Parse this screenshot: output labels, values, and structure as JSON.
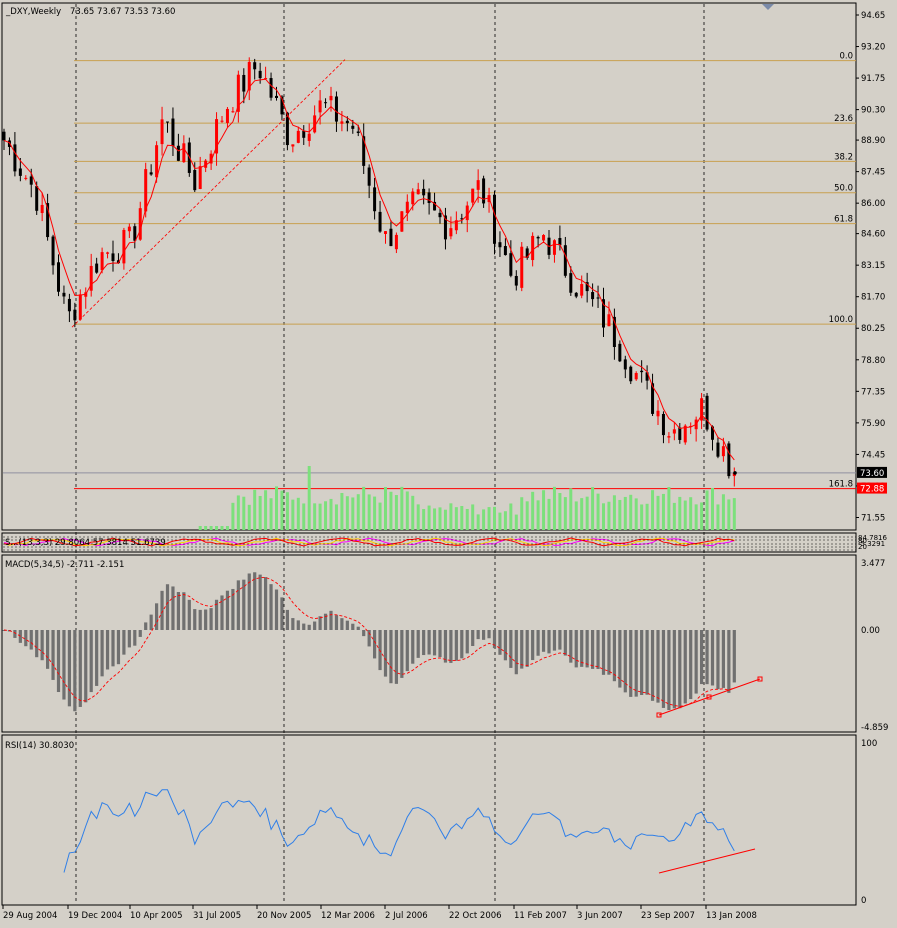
{
  "header": {
    "symbol": "_DXY,Weekly",
    "ohlc": "73.65 73.67 73.53 73.60",
    "menu_icon": "triangle-down-icon"
  },
  "colors": {
    "background": "#d4d0c8",
    "bull_candle": "#ff0000",
    "bear_candle": "#000000",
    "moving_average": "#ff0000",
    "fibonacci": "#c8a050",
    "volume": "#7ce07c",
    "macd_histogram": "#707070",
    "macd_signal": "#ff0000",
    "rsi_line": "#2f7fe8",
    "trendline": "#ff0000"
  },
  "price_axis": {
    "ticks": [
      "94.65",
      "93.20",
      "91.75",
      "90.30",
      "88.90",
      "87.45",
      "86.00",
      "84.60",
      "83.15",
      "81.70",
      "80.25",
      "78.80",
      "77.35",
      "75.90",
      "74.45",
      "73.00",
      "71.55"
    ],
    "current_price": "73.60",
    "red_level": "72.88"
  },
  "fibonacci": {
    "levels": [
      {
        "label": "0.0",
        "price": 92.55
      },
      {
        "label": "23.6",
        "price": 89.68
      },
      {
        "label": "38.2",
        "price": 87.92
      },
      {
        "label": "50.0",
        "price": 86.48
      },
      {
        "label": "61.8",
        "price": 85.06
      },
      {
        "label": "100.0",
        "price": 80.44
      },
      {
        "label": "161.8",
        "price": 72.88
      }
    ]
  },
  "indicators": {
    "stoch": {
      "label": "S...(13,3,3) 29.8064 57.3814 51.6739",
      "axis_labels": [
        "80",
        "20"
      ],
      "axis_values": [
        "84.7816",
        "-5.3291"
      ]
    },
    "macd": {
      "label": "MACD(5,34,5) -2.711 -2.151",
      "axis_labels": [
        "3.477",
        "0.00",
        "-4.859"
      ]
    },
    "rsi": {
      "label": "RSI(14) 30.8030",
      "axis_labels": [
        "100",
        "0"
      ]
    }
  },
  "time_axis": {
    "labels": [
      "29 Aug 2004",
      "19 Dec 2004",
      "10 Apr 2005",
      "31 Jul 2005",
      "20 Nov 2005",
      "12 Mar 2006",
      "2 Jul 2006",
      "22 Oct 2006",
      "11 Feb 2007",
      "3 Jun 2007",
      "23 Sep 2007",
      "13 Jan 2008"
    ]
  },
  "chart_data": {
    "type": "candlestick",
    "timeframe": "Weekly",
    "symbol": "_DXY",
    "ylim": [
      71.0,
      95.3
    ],
    "close_series_anchors": [
      {
        "x": "29 Aug 2004",
        "close": 88.9
      },
      {
        "x": "Oct 2004",
        "close": 86.5
      },
      {
        "x": "19 Dec 2004",
        "close": 80.6
      },
      {
        "x": "Feb 2005",
        "close": 83.6
      },
      {
        "x": "10 Apr 2005",
        "close": 84.2
      },
      {
        "x": "May 2005",
        "close": 89.9
      },
      {
        "x": "31 Jul 2005",
        "close": 87.0
      },
      {
        "x": "Sep 2005",
        "close": 90.5
      },
      {
        "x": "20 Nov 2005",
        "close": 92.4
      },
      {
        "x": "Dec 2005",
        "close": 89.0
      },
      {
        "x": "Jan 2006",
        "close": 90.5
      },
      {
        "x": "12 Mar 2006",
        "close": 89.5
      },
      {
        "x": "Apr 2006",
        "close": 84.3
      },
      {
        "x": "2 Jul 2006",
        "close": 86.0
      },
      {
        "x": "Aug 2006",
        "close": 85.0
      },
      {
        "x": "22 Oct 2006",
        "close": 86.8
      },
      {
        "x": "Dec 2006",
        "close": 82.6
      },
      {
        "x": "11 Feb 2007",
        "close": 84.6
      },
      {
        "x": "3 Jun 2007",
        "close": 82.3
      },
      {
        "x": "Jul 2007",
        "close": 80.5
      },
      {
        "x": "23 Sep 2007",
        "close": 77.9
      },
      {
        "x": "Nov 2007",
        "close": 75.5
      },
      {
        "x": "13 Jan 2008",
        "close": 76.6
      },
      {
        "x": "Feb 2008",
        "close": 73.6
      }
    ],
    "last_close": 73.6,
    "rsi_last": 30.803,
    "macd_last": -2.711,
    "macd_signal_last": -2.151,
    "macd_range": [
      -4.859,
      3.477
    ]
  }
}
